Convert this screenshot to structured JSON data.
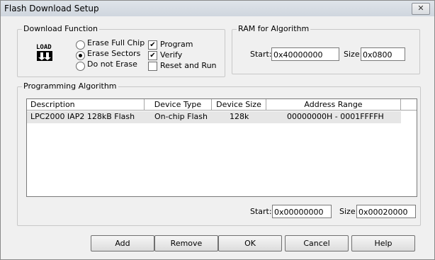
{
  "window": {
    "title": "Flash Download Setup",
    "close_glyph": "✕"
  },
  "download_function": {
    "legend": "Download Function",
    "load_icon_text": "LOAD",
    "radios": [
      {
        "label": "Erase Full Chip",
        "selected": false
      },
      {
        "label": "Erase Sectors",
        "selected": true
      },
      {
        "label": "Do not Erase",
        "selected": false
      }
    ],
    "checks": [
      {
        "label": "Program",
        "checked": true
      },
      {
        "label": "Verify",
        "checked": true
      },
      {
        "label": "Reset and Run",
        "checked": false
      }
    ]
  },
  "ram": {
    "legend": "RAM for Algorithm",
    "start_label": "Start:",
    "start_value": "0x40000000",
    "size_label": "Size:",
    "size_value": "0x0800"
  },
  "algorithm": {
    "legend": "Programming Algorithm",
    "columns": [
      "Description",
      "Device Type",
      "Device Size",
      "Address Range"
    ],
    "rows": [
      {
        "description": "LPC2000 IAP2 128kB Flash",
        "device_type": "On-chip Flash",
        "device_size": "128k",
        "address_range": "00000000H - 0001FFFFH"
      }
    ],
    "start_label": "Start:",
    "start_value": "0x00000000",
    "size_label": "Size:",
    "size_value": "0x00020000"
  },
  "buttons": {
    "add": "Add",
    "remove": "Remove",
    "ok": "OK",
    "cancel": "Cancel",
    "help": "Help"
  },
  "colors": {
    "titlebar": "#d6dce4",
    "selection": "#e6e6e6",
    "dialog_bg": "#f0f0f0"
  }
}
